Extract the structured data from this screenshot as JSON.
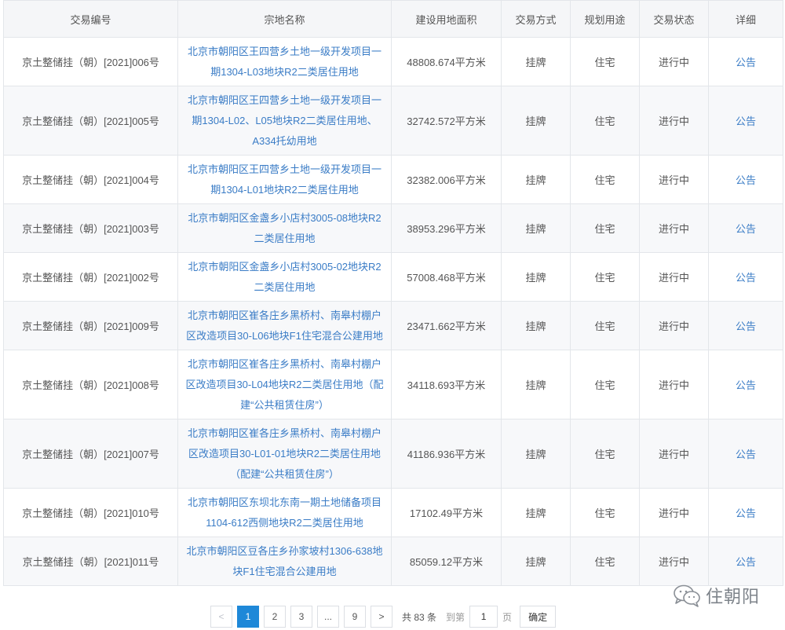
{
  "table": {
    "headers": [
      "交易编号",
      "宗地名称",
      "建设用地面积",
      "交易方式",
      "规划用途",
      "交易状态",
      "详细"
    ],
    "rows": [
      {
        "code": "京土整储挂（朝）[2021]006号",
        "name": "北京市朝阳区王四营乡土地一级开发项目一期1304-L03地块R2二类居住用地",
        "area": "48808.674平方米",
        "method": "挂牌",
        "use": "住宅",
        "status": "进行中",
        "detail": "公告"
      },
      {
        "code": "京土整储挂（朝）[2021]005号",
        "name": "北京市朝阳区王四营乡土地一级开发项目一期1304-L02、L05地块R2二类居住用地、A334托幼用地",
        "area": "32742.572平方米",
        "method": "挂牌",
        "use": "住宅",
        "status": "进行中",
        "detail": "公告"
      },
      {
        "code": "京土整储挂（朝）[2021]004号",
        "name": "北京市朝阳区王四营乡土地一级开发项目一期1304-L01地块R2二类居住用地",
        "area": "32382.006平方米",
        "method": "挂牌",
        "use": "住宅",
        "status": "进行中",
        "detail": "公告"
      },
      {
        "code": "京土整储挂（朝）[2021]003号",
        "name": "北京市朝阳区金盏乡小店村3005-08地块R2二类居住用地",
        "area": "38953.296平方米",
        "method": "挂牌",
        "use": "住宅",
        "status": "进行中",
        "detail": "公告"
      },
      {
        "code": "京土整储挂（朝）[2021]002号",
        "name": "北京市朝阳区金盏乡小店村3005-02地块R2二类居住用地",
        "area": "57008.468平方米",
        "method": "挂牌",
        "use": "住宅",
        "status": "进行中",
        "detail": "公告"
      },
      {
        "code": "京土整储挂（朝）[2021]009号",
        "name": "北京市朝阳区崔各庄乡黑桥村、南皋村棚户区改造项目30-L06地块F1住宅混合公建用地",
        "area": "23471.662平方米",
        "method": "挂牌",
        "use": "住宅",
        "status": "进行中",
        "detail": "公告"
      },
      {
        "code": "京土整储挂（朝）[2021]008号",
        "name": "北京市朝阳区崔各庄乡黑桥村、南皋村棚户区改造项目30-L04地块R2二类居住用地（配建“公共租赁住房”）",
        "area": "34118.693平方米",
        "method": "挂牌",
        "use": "住宅",
        "status": "进行中",
        "detail": "公告"
      },
      {
        "code": "京土整储挂（朝）[2021]007号",
        "name": "北京市朝阳区崔各庄乡黑桥村、南皋村棚户区改造项目30-L01-01地块R2二类居住用地（配建“公共租赁住房”）",
        "area": "41186.936平方米",
        "method": "挂牌",
        "use": "住宅",
        "status": "进行中",
        "detail": "公告"
      },
      {
        "code": "京土整储挂（朝）[2021]010号",
        "name": "北京市朝阳区东坝北东南一期土地储备项目1104-612西侧地块R2二类居住用地",
        "area": "17102.49平方米",
        "method": "挂牌",
        "use": "住宅",
        "status": "进行中",
        "detail": "公告"
      },
      {
        "code": "京土整储挂（朝）[2021]011号",
        "name": "北京市朝阳区豆各庄乡孙家坡村1306-638地块F1住宅混合公建用地",
        "area": "85059.12平方米",
        "method": "挂牌",
        "use": "住宅",
        "status": "进行中",
        "detail": "公告"
      }
    ]
  },
  "pagination": {
    "prev": "<",
    "pages": [
      "1",
      "2",
      "3",
      "...",
      "9"
    ],
    "active_page": "1",
    "next": ">",
    "total": "共 83 条",
    "goto_label": "到第",
    "goto_value": "1",
    "page_unit": "页",
    "confirm": "确定"
  },
  "watermark": {
    "text": "住朝阳",
    "icon": "wechat-icon"
  },
  "colors": {
    "link": "#3a7cc6",
    "active_page": "#1e88d8",
    "header_bg": "#f5f6f8"
  }
}
